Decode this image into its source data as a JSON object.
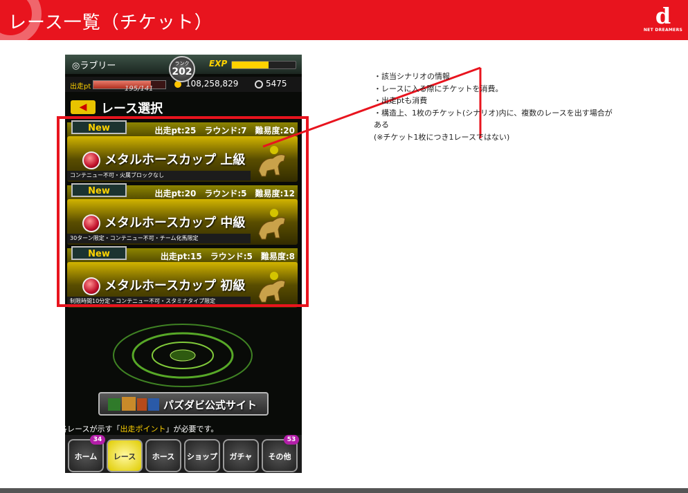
{
  "slide": {
    "title": "レース一覧（チケット）",
    "logo": {
      "mark": "d",
      "text": "NET DREAMERS"
    }
  },
  "game": {
    "player_name": "◎ラブリー",
    "rank": {
      "label": "ランク",
      "value": "202"
    },
    "exp_label": "EXP",
    "exp_progress": 0.58,
    "stamina_label": "出走pt",
    "stamina_value": "195/141",
    "stamina_progress": 0.8,
    "coins": "108,258,829",
    "gems": "5475",
    "section_title": "レース選択",
    "races": [
      {
        "tag": "New",
        "info": "出走pt:25　ラウンド:7　難易度:20",
        "name": "メタルホースカップ 上級",
        "conditions": "コンテニュー不可・火属ブロックなし"
      },
      {
        "tag": "New",
        "info": "出走pt:20　ラウンド:5　難易度:12",
        "name": "メタルホースカップ 中級",
        "conditions": "30ターン限定・コンテニュー不可・チーム化馬限定"
      },
      {
        "tag": "New",
        "info": "出走pt:15　ラウンド:5　難易度:8",
        "name": "メタルホースカップ 初級",
        "conditions": "制限時間10分定・コンテニュー不可・スタミナタイプ限定"
      }
    ],
    "site_button": "パズダビ公式サイト",
    "note_prefix": "各レースが示す「",
    "note_highlight": "出走ポイント",
    "note_suffix": "」が必要です。",
    "nav": [
      {
        "label": "ホーム",
        "badge": "34"
      },
      {
        "label": "レース",
        "badge": ""
      },
      {
        "label": "ホース",
        "badge": ""
      },
      {
        "label": "ショップ",
        "badge": ""
      },
      {
        "label": "ガチャ",
        "badge": ""
      },
      {
        "label": "その他",
        "badge": "53"
      }
    ]
  },
  "notes": [
    "・該当シナリオの情報",
    "・レースに入る際にチケットを消費。",
    "・出走ptも消費",
    "・構造上、1枚のチケット(シナリオ)内に、複数のレースを出す場合が",
    "ある",
    "(※チケット1枚につき1レースではない)"
  ],
  "colors": {
    "accent": "#e8141e",
    "gold": "#ffd200"
  }
}
